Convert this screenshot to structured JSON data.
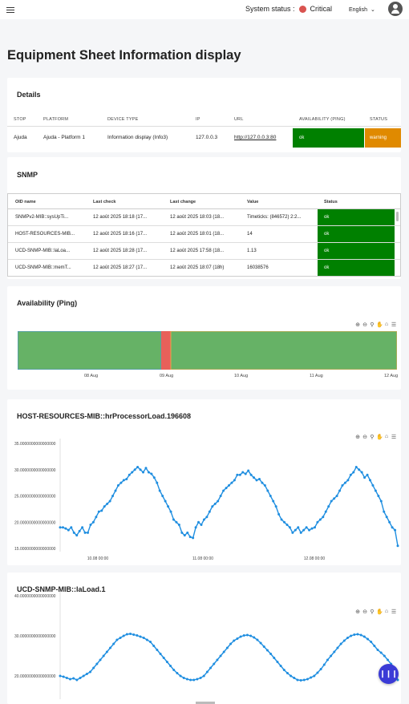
{
  "topbar": {
    "status_label": "System status :",
    "status_value": "Critical",
    "status_color": "#d9534f",
    "language": "English"
  },
  "page_title": "Equipment Sheet Information display",
  "details": {
    "title": "Details",
    "columns": [
      "STOP",
      "PLATFORM",
      "DEVICE TYPE",
      "IP",
      "URL",
      "AVAILABILITY (PING)",
      "STATUS"
    ],
    "row": {
      "stop": "Ajuda",
      "platform": "Ajuda - Platform 1",
      "device_type": "Information display (Info3)",
      "ip": "127.0.0.3",
      "url": "http://127.0.0.3:80",
      "availability": "ok",
      "status": "warning"
    }
  },
  "snmp": {
    "title": "SNMP",
    "columns": [
      "OID name",
      "Last check",
      "Last change",
      "Value",
      "Status"
    ],
    "rows": [
      {
        "oid": "SNMPv2-MIB::sysUpTi...",
        "last_check": "12 août 2025 18:18 (17...",
        "last_change": "12 août 2025 18:03 (18...",
        "value": "Timeticks: (846572) 2:2...",
        "status": "ok"
      },
      {
        "oid": "HOST-RESOURCES-MIB...",
        "last_check": "12 août 2025 18:16 (17...",
        "last_change": "12 août 2025 18:01 (18...",
        "value": "14",
        "status": "ok"
      },
      {
        "oid": "UCD-SNMP-MIB::laLoa...",
        "last_check": "12 août 2025 18:28 (17...",
        "last_change": "12 août 2025 17:58 (18...",
        "value": "1.13",
        "status": "ok"
      },
      {
        "oid": "UCD-SNMP-MIB::memT...",
        "last_check": "12 août 2025 18:27 (17...",
        "last_change": "12 août 2025 18:07 (18h)",
        "value": "16038576",
        "status": "ok"
      }
    ]
  },
  "availability_chart": {
    "title": "Availability (Ping)",
    "x_ticks": [
      "08 Aug",
      "09 Aug",
      "10 Aug",
      "11 Aug",
      "12 Aug"
    ],
    "colors": {
      "up": "#66b266",
      "down": "#e8605a",
      "edge": "#4a90d9"
    }
  },
  "cpu_chart": {
    "title": "HOST-RESOURCES-MIB::hrProcessorLoad.196608",
    "y_ticks": [
      "35.0000000000000000",
      "30.0000000000000000",
      "25.0000000000000000",
      "20.0000000000000000",
      "15.0000000000000000"
    ],
    "x_ticks": [
      "10.08 00:00",
      "11.08 00:00",
      "12.08 00:00"
    ]
  },
  "la_chart": {
    "title": "UCD-SNMP-MIB::laLoad.1",
    "y_ticks": [
      "40.0000000000000000",
      "30.0000000000000000",
      "20.0000000000000000"
    ]
  },
  "chart_data": [
    {
      "type": "line",
      "title": "HOST-RESOURCES-MIB::hrProcessorLoad.196608",
      "ylim": [
        15,
        35
      ],
      "series": [
        {
          "values": [
            19,
            19,
            18.8,
            18.5,
            19,
            18,
            17.5,
            18.3,
            19,
            18,
            18,
            19.5,
            20,
            21,
            22,
            22.2,
            23,
            23.5,
            24,
            25,
            26,
            27,
            27.5,
            28,
            28.2,
            29,
            29.5,
            30,
            30.5,
            30,
            29.5,
            30.3,
            29.5,
            29.2,
            28.5,
            27.5,
            26,
            25,
            24,
            23,
            22,
            20.5,
            20,
            19.5,
            18,
            17.5,
            18,
            17.2,
            17,
            19,
            20,
            19.5,
            20.5,
            21,
            22,
            23,
            23.5,
            24,
            25,
            26,
            26.5,
            27,
            27.5,
            28,
            29,
            29,
            29.5,
            29.2,
            29.8,
            29,
            28.5,
            28,
            28.2,
            27.5,
            27,
            26,
            25,
            24,
            23,
            21.5,
            20.5,
            20,
            19.5,
            19,
            18,
            18.5,
            19,
            18,
            18.5,
            19,
            18.5,
            18.8,
            19,
            20,
            20.5,
            21,
            22,
            23,
            24,
            24.5,
            25,
            26,
            27,
            27.5,
            28,
            29,
            29.5,
            30.5,
            30,
            29.5,
            28.5,
            29,
            28,
            27,
            26,
            25,
            24,
            22,
            21,
            20,
            19,
            18.5,
            15.5
          ]
        }
      ]
    },
    {
      "type": "line",
      "title": "UCD-SNMP-MIB::laLoad.1",
      "ylim": [
        15,
        40
      ],
      "series": [
        {
          "values": [
            20,
            19.8,
            19.5,
            19.2,
            19.4,
            19,
            19.5,
            20,
            20.5,
            21,
            22,
            23,
            24,
            25,
            26,
            27,
            28,
            29,
            29.5,
            30,
            30.4,
            30.5,
            30.3,
            30.1,
            29.8,
            29.5,
            29,
            28.5,
            27.5,
            26.5,
            25.5,
            24.5,
            23.5,
            22.5,
            21.5,
            20.7,
            20,
            19.5,
            19.2,
            19,
            19,
            19.2,
            19.5,
            20,
            21,
            22,
            23,
            24,
            25,
            26,
            27,
            28,
            28.8,
            29.3,
            29.8,
            30.1,
            30.2,
            30,
            29.6,
            29,
            28.2,
            27.3,
            26.4,
            25.5,
            24.5,
            23.5,
            22.5,
            21.5,
            20.7,
            20,
            19.5,
            19,
            18.9,
            19,
            19.2,
            19.6,
            20,
            20.8,
            21.7,
            22.8,
            24,
            25,
            26,
            27,
            28,
            28.8,
            29.5,
            30,
            30.3,
            30.4,
            30.2,
            29.8,
            29.2,
            28.5,
            27.5,
            26.5,
            25.8,
            25,
            24,
            23,
            22,
            19
          ]
        }
      ]
    }
  ]
}
